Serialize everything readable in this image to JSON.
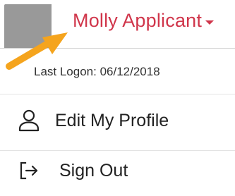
{
  "header": {
    "user_name": "Molly Applicant",
    "avatar_color": "#999999",
    "accent_color": "#d0364b",
    "annotation_arrow_color": "#f5a41d",
    "icons": {
      "avatar": "avatar",
      "caret": "caret-down-icon",
      "arrow": "orange-arrow-icon"
    }
  },
  "dropdown": {
    "last_logon": "Last Logon: 06/12/2018",
    "items": [
      {
        "label": "Edit My Profile",
        "icon": "user-icon"
      },
      {
        "label": "Sign Out",
        "icon": "sign-out-icon"
      }
    ]
  }
}
